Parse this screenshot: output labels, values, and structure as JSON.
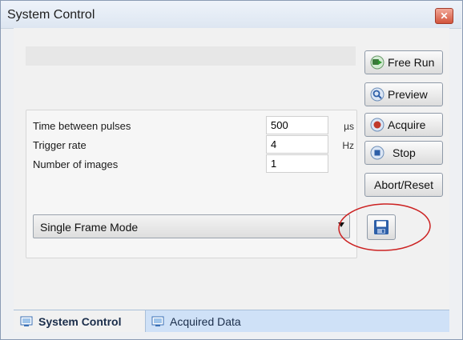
{
  "window": {
    "title": "System Control",
    "close_glyph": "✕"
  },
  "parameters": [
    {
      "label": "Time between pulses",
      "value": "500",
      "unit": "µs"
    },
    {
      "label": "Trigger rate",
      "value": "4",
      "unit": "Hz"
    },
    {
      "label": "Number of images",
      "value": "1",
      "unit": ""
    }
  ],
  "mode_select": {
    "selected": "Single Frame Mode"
  },
  "buttons": {
    "free_run": {
      "label": "Free Run",
      "icon": "camera-play-icon",
      "color": "#3a9a3a"
    },
    "preview": {
      "label": "Preview",
      "icon": "magnifier-icon",
      "color": "#3a6fb5"
    },
    "acquire": {
      "label": "Acquire",
      "icon": "record-icon",
      "color": "#c0392b"
    },
    "stop": {
      "label": "Stop",
      "icon": "stop-icon",
      "color": "#2d5fa8"
    },
    "abort_reset": {
      "label": "Abort/Reset"
    },
    "save": {
      "icon": "floppy-disk-icon",
      "color": "#2d5fa8"
    }
  },
  "tabs": [
    {
      "label": "System Control",
      "icon": "system-control-icon",
      "active": true
    },
    {
      "label": "Acquired Data",
      "icon": "acquired-data-icon",
      "active": false
    }
  ],
  "annotation": {
    "color": "#cc2222"
  }
}
